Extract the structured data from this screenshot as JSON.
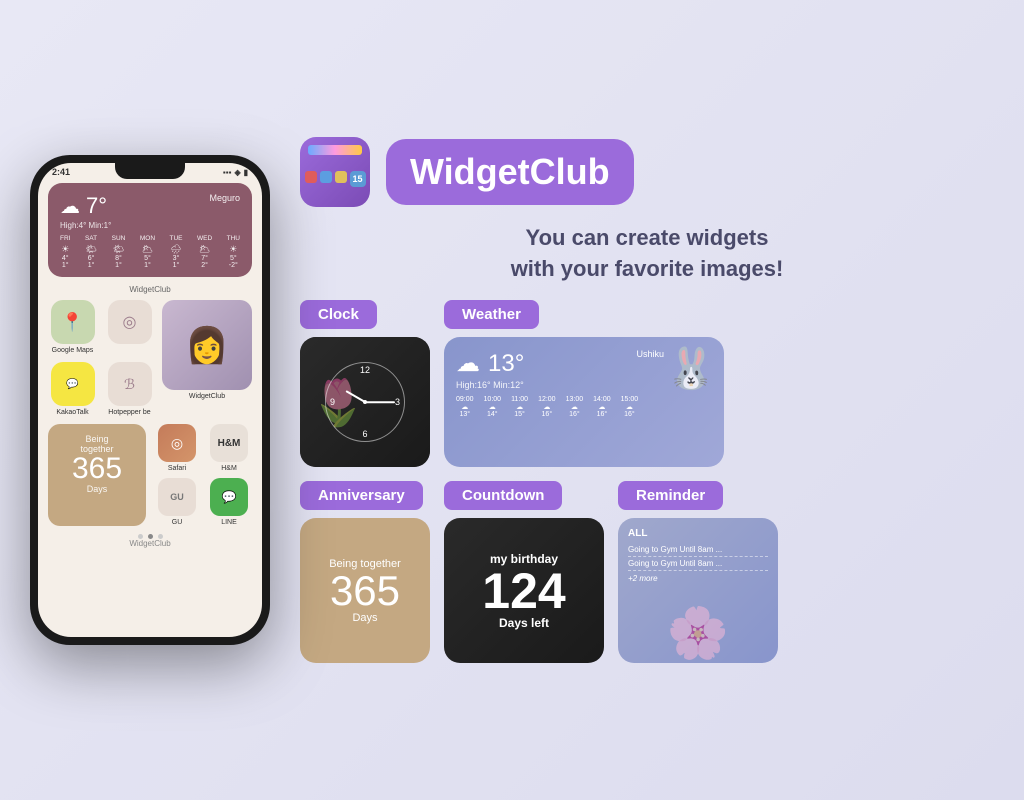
{
  "background": "#e8e8f0",
  "phone": {
    "time": "2:41",
    "weather": {
      "temp": "7°",
      "location": "Meguro",
      "minmax": "High:4° Min:1°",
      "days": [
        {
          "name": "FRI",
          "icon": "☀",
          "high": "4°",
          "low": "1°"
        },
        {
          "name": "SAT",
          "icon": "🌤",
          "high": "6°",
          "low": "1°"
        },
        {
          "name": "SUN",
          "icon": "🌤",
          "high": "8°",
          "low": "1°"
        },
        {
          "name": "MON",
          "icon": "🌥",
          "high": "5°",
          "low": "1°"
        },
        {
          "name": "TUE",
          "icon": "🌧",
          "high": "3°",
          "low": "1°"
        },
        {
          "name": "WED",
          "icon": "🌥",
          "high": "7°",
          "low": "2°"
        },
        {
          "name": "THU",
          "icon": "☀",
          "high": "5°",
          "low": "-2°"
        }
      ]
    },
    "widget_club_label": "WidgetClub",
    "apps": {
      "google_maps": "Google Maps",
      "kakao_talk": "KakaoTalk",
      "hotpepper": "Hotpepper be",
      "widget_club": "WidgetClub",
      "safari": "Safari",
      "hm": "H&M",
      "gu": "GU",
      "line": "LINE",
      "widget_club_bottom": "WidgetClub"
    },
    "anniversary": {
      "being": "Being",
      "together": "together",
      "number": "365",
      "days": "Days"
    }
  },
  "right": {
    "app_name": "WidgetClub",
    "tagline_line1": "You can create widgets",
    "tagline_line2": "with your favorite images!",
    "categories": {
      "clock": "Clock",
      "weather": "Weather",
      "anniversary": "Anniversary",
      "countdown": "Countdown",
      "reminder": "Reminder"
    },
    "clock_preview": {
      "h12": "12",
      "h3": "3",
      "h6": "6",
      "h9": "9"
    },
    "weather_preview": {
      "temp": "13°",
      "location": "Ushiku",
      "minmax": "High:16° Min:12°",
      "hours": [
        "09:00",
        "10:00",
        "11:00",
        "12:00",
        "13:00",
        "14:00",
        "15:00"
      ],
      "temps": [
        "13°",
        "14°",
        "15°",
        "16°",
        "16°",
        "16°",
        "16°"
      ]
    },
    "anniversary_preview": {
      "being": "Being together",
      "number": "365",
      "days": "Days"
    },
    "countdown_preview": {
      "label": "my birthday",
      "number": "124",
      "days_left": "Days left"
    },
    "reminder_preview": {
      "all": "ALL",
      "items": [
        "Going to Gym Until 8am ...",
        "Going to Gym Until 8am ..."
      ],
      "more": "+2 more"
    }
  }
}
